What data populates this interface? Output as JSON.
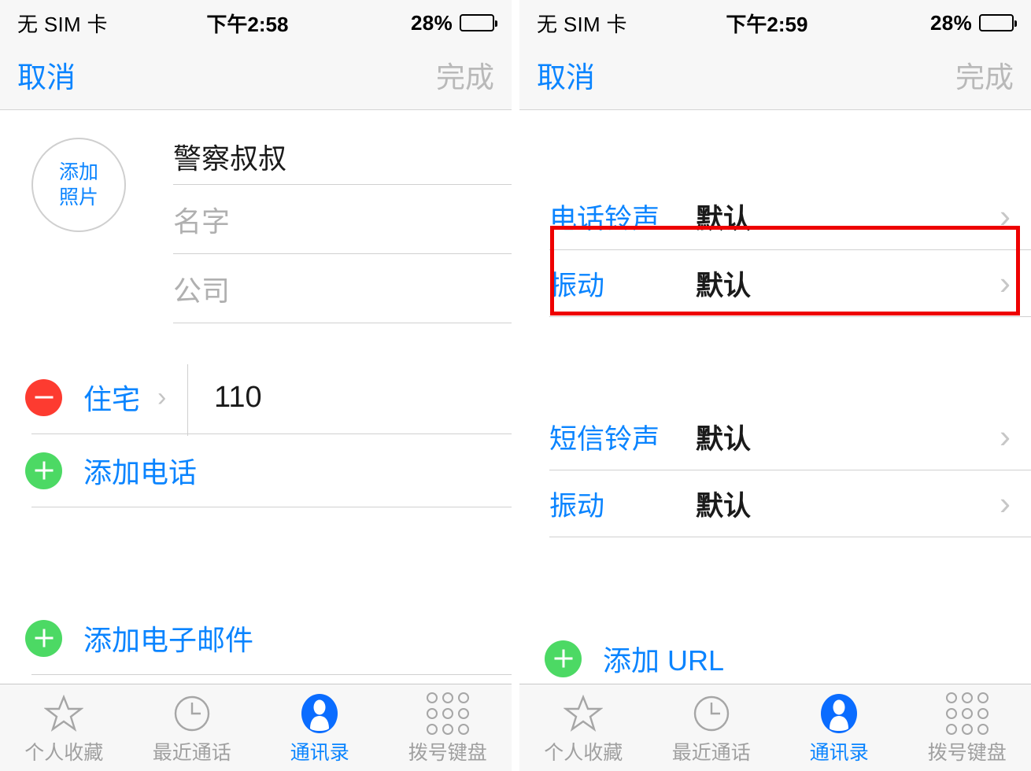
{
  "left": {
    "status": {
      "carrier": "无 SIM 卡",
      "time": "下午2:58",
      "battery_percent": "28%",
      "battery_level": 28
    },
    "nav": {
      "cancel": "取消",
      "done": "完成"
    },
    "photo": {
      "line1": "添加",
      "line2": "照片"
    },
    "fields": [
      {
        "value": "警察叔叔",
        "placeholder": "",
        "filled": true
      },
      {
        "value": "",
        "placeholder": "名字",
        "filled": false
      },
      {
        "value": "",
        "placeholder": "公司",
        "filled": false
      }
    ],
    "phone_row": {
      "label": "住宅",
      "value": "110",
      "chevron": "›"
    },
    "add_phone": "添加电话",
    "add_email": "添加电子邮件"
  },
  "right": {
    "status": {
      "carrier": "无 SIM 卡",
      "time": "下午2:59",
      "battery_percent": "28%",
      "battery_level": 28
    },
    "nav": {
      "cancel": "取消",
      "done": "完成"
    },
    "rows_group1": [
      {
        "label": "电话铃声",
        "value": "默认",
        "chevron": "›"
      },
      {
        "label": "振动",
        "value": "默认",
        "chevron": "›"
      }
    ],
    "rows_group2": [
      {
        "label": "短信铃声",
        "value": "默认",
        "chevron": "›"
      },
      {
        "label": "振动",
        "value": "默认",
        "chevron": "›"
      }
    ],
    "add_url": "添加 URL",
    "highlight_color": "#ee0000"
  },
  "tabbar": {
    "items": [
      {
        "label": "个人收藏",
        "icon": "star-icon",
        "active": false
      },
      {
        "label": "最近通话",
        "icon": "clock-icon",
        "active": false
      },
      {
        "label": "通讯录",
        "icon": "contacts-person-icon",
        "active": true
      },
      {
        "label": "拨号键盘",
        "icon": "keypad-icon",
        "active": false
      }
    ]
  },
  "colors": {
    "accent_blue": "#0a84ff",
    "add_green": "#4cd964",
    "remove_red": "#fd3b30",
    "disabled_gray": "#b9b9b9",
    "highlight_red": "#ee0000"
  }
}
